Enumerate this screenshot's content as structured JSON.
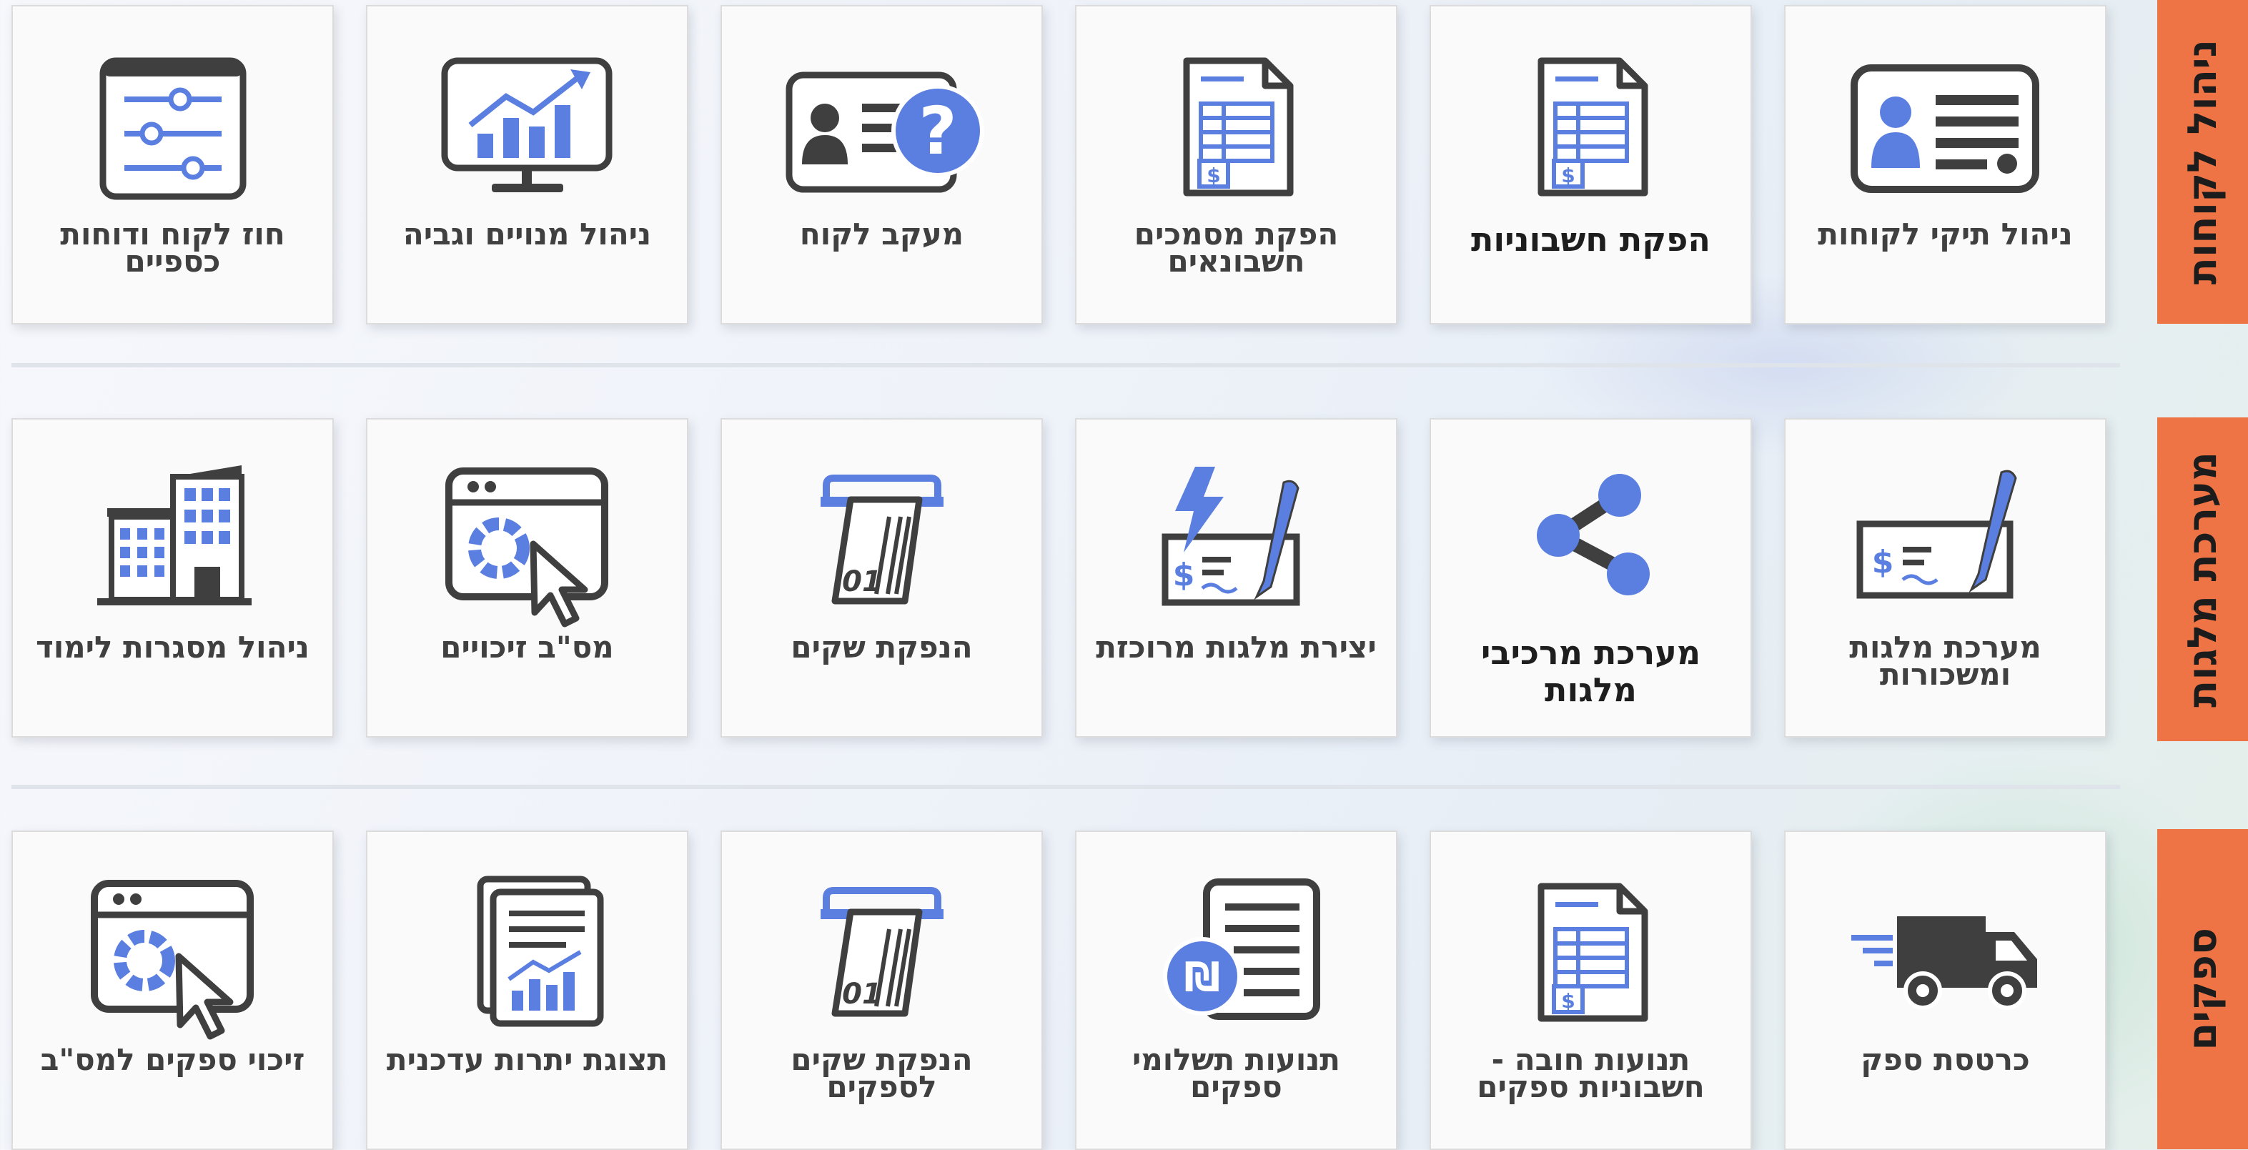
{
  "colors": {
    "accent_orange": "#ee7446",
    "icon_blue": "#5b7fe0",
    "icon_dark": "#3f3f3f",
    "card_bg": "#fafafa"
  },
  "sections": [
    {
      "title": "ניהול לקוחות",
      "cards": [
        {
          "label": "ניהול תיקי לקוחות",
          "icon": "customer-id-card-icon"
        },
        {
          "label": "הפקת חשבוניות",
          "icon": "invoice-document-icon"
        },
        {
          "label": "הפקת מסמכים חשבונאים",
          "icon": "invoice-document-icon"
        },
        {
          "label": "מעקב לקוח",
          "icon": "id-card-question-icon"
        },
        {
          "label": "ניהול מנויים וגביה",
          "icon": "monitor-chart-icon"
        },
        {
          "label": "חוז לקוח ודוחות כספיים",
          "icon": "settings-sliders-icon"
        }
      ]
    },
    {
      "title": "מערכת מלגות",
      "cards": [
        {
          "label": "מערכת מלגות ומשכורות",
          "icon": "check-pen-icon"
        },
        {
          "label": "מערכת מרכיבי מלגות",
          "icon": "share-nodes-icon"
        },
        {
          "label": "יצירת מלגות מרוכזת",
          "icon": "lightning-check-icon"
        },
        {
          "label": "הנפקת שקים",
          "icon": "check-print-icon"
        },
        {
          "label": "מס\"ב זיכויים",
          "icon": "browser-click-icon"
        },
        {
          "label": "ניהול מסגרות לימוד",
          "icon": "buildings-icon"
        }
      ]
    },
    {
      "title": "ספקים",
      "cards": [
        {
          "label": "כרטסת ספק",
          "icon": "delivery-truck-icon"
        },
        {
          "label": "תנועות חובה - חשבוניות ספקים",
          "icon": "invoice-document-icon"
        },
        {
          "label": "תנועות תשלומי ספקים",
          "icon": "shekel-document-icon"
        },
        {
          "label": "הנפקת שקים לספקים",
          "icon": "check-print-icon"
        },
        {
          "label": "תצוגת יתרות עדכנית",
          "icon": "report-chart-icon"
        },
        {
          "label": "זיכוי ספקים למס\"ב",
          "icon": "browser-click-icon"
        }
      ]
    }
  ]
}
